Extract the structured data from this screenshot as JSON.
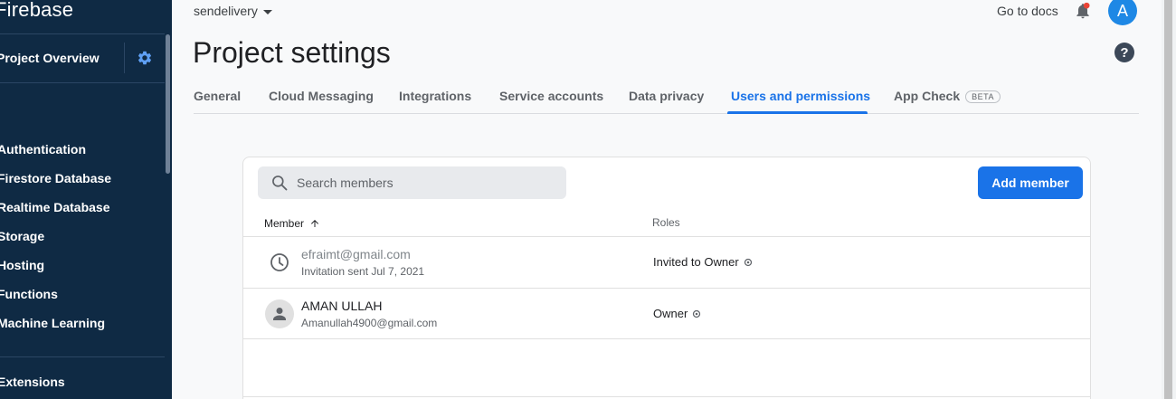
{
  "sidebar": {
    "brand": "Firebase",
    "project_overview": "Project Overview",
    "items": [
      {
        "label": "Authentication"
      },
      {
        "label": "Firestore Database"
      },
      {
        "label": "Realtime Database"
      },
      {
        "label": "Storage"
      },
      {
        "label": "Hosting"
      },
      {
        "label": "Functions"
      },
      {
        "label": "Machine Learning"
      }
    ],
    "extensions": "Extensions"
  },
  "header": {
    "project_name": "sendelivery",
    "docs_link": "Go to docs",
    "avatar_letter": "A",
    "page_title": "Project settings"
  },
  "tabs": [
    {
      "label": "General"
    },
    {
      "label": "Cloud Messaging"
    },
    {
      "label": "Integrations"
    },
    {
      "label": "Service accounts"
    },
    {
      "label": "Data privacy"
    },
    {
      "label": "Users and permissions",
      "active": true
    },
    {
      "label": "App Check",
      "badge": "BETA"
    }
  ],
  "members": {
    "search_placeholder": "Search members",
    "add_button": "Add member",
    "columns": {
      "member": "Member",
      "roles": "Roles"
    },
    "rows": [
      {
        "name": "efraimt@gmail.com",
        "sub": "Invitation sent Jul 7, 2021",
        "role": "Invited to Owner",
        "icon": "clock-icon",
        "pending": true
      },
      {
        "name": "AMAN ULLAH",
        "sub": "Amanullah4900@gmail.com",
        "role": "Owner",
        "icon": "person-avatar-icon",
        "pending": false
      }
    ]
  },
  "colors": {
    "sidebar_bg": "#0f2a44",
    "accent": "#1a73e8",
    "avatar": "#1e88e5",
    "notification_dot": "#ea4335"
  }
}
